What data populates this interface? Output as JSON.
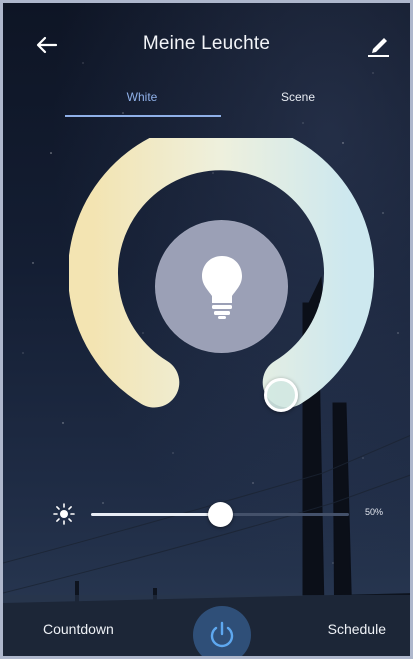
{
  "header": {
    "title": "Meine Leuchte",
    "back_icon": "arrow-left-icon",
    "edit_icon": "pencil-edit-icon"
  },
  "tabs": [
    {
      "label": "White",
      "active": true
    },
    {
      "label": "Scene",
      "active": false
    }
  ],
  "color_temperature_wheel": {
    "warm_color": "#f2e3b0",
    "cool_color": "#cfe9f0",
    "center_icon": "lightbulb-icon"
  },
  "brightness": {
    "icon": "sun-icon",
    "value_percent": 50,
    "label": "50%"
  },
  "bottom_bar": {
    "countdown_label": "Countdown",
    "schedule_label": "Schedule",
    "power_icon": "power-icon",
    "power_color": "#5ea8f0"
  },
  "colors": {
    "accent": "#8fb0e8",
    "background": "#141e33"
  }
}
